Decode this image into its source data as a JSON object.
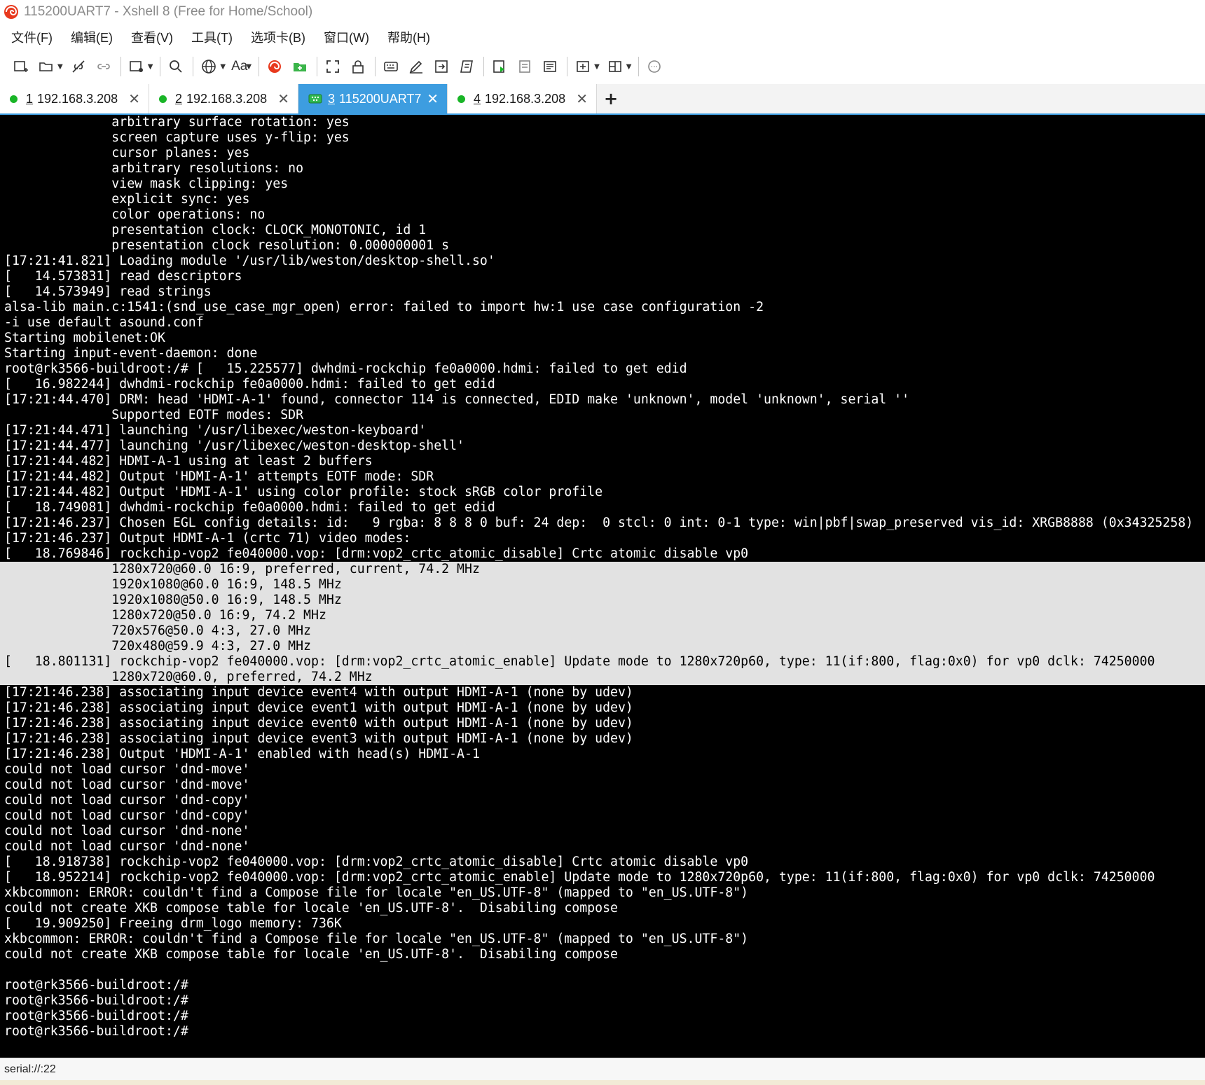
{
  "window": {
    "title": "115200UART7 - Xshell 8 (Free for Home/School)"
  },
  "menu": [
    {
      "label": "文件(F)"
    },
    {
      "label": "编辑(E)"
    },
    {
      "label": "查看(V)"
    },
    {
      "label": "工具(T)"
    },
    {
      "label": "选项卡(B)"
    },
    {
      "label": "窗口(W)"
    },
    {
      "label": "帮助(H)"
    }
  ],
  "toolbar": {
    "font_button_label": "Aa"
  },
  "tabs": [
    {
      "num": "1",
      "label": "192.168.3.208",
      "status_color": "#19b527"
    },
    {
      "num": "2",
      "label": "192.168.3.208",
      "status_color": "#19b527"
    },
    {
      "num": "3",
      "label": "115200UART7",
      "active": true
    },
    {
      "num": "4",
      "label": "192.168.3.208",
      "status_color": "#19b527"
    }
  ],
  "tab_add_label": "+",
  "tab_close_label": "✕",
  "terminal": {
    "lines": [
      {
        "text": "              arbitrary surface rotation: yes"
      },
      {
        "text": "              screen capture uses y-flip: yes"
      },
      {
        "text": "              cursor planes: yes"
      },
      {
        "text": "              arbitrary resolutions: no"
      },
      {
        "text": "              view mask clipping: yes"
      },
      {
        "text": "              explicit sync: yes"
      },
      {
        "text": "              color operations: no"
      },
      {
        "text": "              presentation clock: CLOCK_MONOTONIC, id 1"
      },
      {
        "text": "              presentation clock resolution: 0.000000001 s"
      },
      {
        "text": "[17:21:41.821] Loading module '/usr/lib/weston/desktop-shell.so'"
      },
      {
        "text": "[   14.573831] read descriptors"
      },
      {
        "text": "[   14.573949] read strings"
      },
      {
        "text": "alsa-lib main.c:1541:(snd_use_case_mgr_open) error: failed to import hw:1 use case configuration -2"
      },
      {
        "text": "-i use default asound.conf"
      },
      {
        "text": "Starting mobilenet:OK"
      },
      {
        "text": "Starting input-event-daemon: done"
      },
      {
        "text": "root@rk3566-buildroot:/# [   15.225577] dwhdmi-rockchip fe0a0000.hdmi: failed to get edid"
      },
      {
        "text": "[   16.982244] dwhdmi-rockchip fe0a0000.hdmi: failed to get edid"
      },
      {
        "text": "[17:21:44.470] DRM: head 'HDMI-A-1' found, connector 114 is connected, EDID make 'unknown', model 'unknown', serial ''"
      },
      {
        "text": "              Supported EOTF modes: SDR"
      },
      {
        "text": "[17:21:44.471] launching '/usr/libexec/weston-keyboard'"
      },
      {
        "text": "[17:21:44.477] launching '/usr/libexec/weston-desktop-shell'"
      },
      {
        "text": "[17:21:44.482] HDMI-A-1 using at least 2 buffers"
      },
      {
        "text": "[17:21:44.482] Output 'HDMI-A-1' attempts EOTF mode: SDR"
      },
      {
        "text": "[17:21:44.482] Output 'HDMI-A-1' using color profile: stock sRGB color profile"
      },
      {
        "text": "[   18.749081] dwhdmi-rockchip fe0a0000.hdmi: failed to get edid"
      },
      {
        "text": "[17:21:46.237] Chosen EGL config details: id:   9 rgba: 8 8 8 0 buf: 24 dep:  0 stcl: 0 int: 0-1 type: win|pbf|swap_preserved vis_id: XRGB8888 (0x34325258)"
      },
      {
        "text": "[17:21:46.237] Output HDMI-A-1 (crtc 71) video modes:"
      },
      {
        "text": "[   18.769846] rockchip-vop2 fe040000.vop: [drm:vop2_crtc_atomic_disable] Crtc atomic disable vp0"
      },
      {
        "text": "              1280x720@60.0 16:9, preferred, current, 74.2 MHz",
        "selected": true
      },
      {
        "text": "              1920x1080@60.0 16:9, 148.5 MHz",
        "selected": true
      },
      {
        "text": "              1920x1080@50.0 16:9, 148.5 MHz",
        "selected": true
      },
      {
        "text": "              1280x720@50.0 16:9, 74.2 MHz",
        "selected": true
      },
      {
        "text": "              720x576@50.0 4:3, 27.0 MHz",
        "selected": true
      },
      {
        "text": "              720x480@59.9 4:3, 27.0 MHz",
        "selected": true
      },
      {
        "text": "[   18.801131] rockchip-vop2 fe040000.vop: [drm:vop2_crtc_atomic_enable] Update mode to 1280x720p60, type: 11(if:800, flag:0x0) for vp0 dclk: 74250000",
        "selected": true
      },
      {
        "text": "              1280x720@60.0, preferred, 74.2 MHz",
        "selected": true
      },
      {
        "text": "[17:21:46.238] associating input device event4 with output HDMI-A-1 (none by udev)"
      },
      {
        "text": "[17:21:46.238] associating input device event1 with output HDMI-A-1 (none by udev)"
      },
      {
        "text": "[17:21:46.238] associating input device event0 with output HDMI-A-1 (none by udev)"
      },
      {
        "text": "[17:21:46.238] associating input device event3 with output HDMI-A-1 (none by udev)"
      },
      {
        "text": "[17:21:46.238] Output 'HDMI-A-1' enabled with head(s) HDMI-A-1"
      },
      {
        "text": "could not load cursor 'dnd-move'"
      },
      {
        "text": "could not load cursor 'dnd-move'"
      },
      {
        "text": "could not load cursor 'dnd-copy'"
      },
      {
        "text": "could not load cursor 'dnd-copy'"
      },
      {
        "text": "could not load cursor 'dnd-none'"
      },
      {
        "text": "could not load cursor 'dnd-none'"
      },
      {
        "text": "[   18.918738] rockchip-vop2 fe040000.vop: [drm:vop2_crtc_atomic_disable] Crtc atomic disable vp0"
      },
      {
        "text": "[   18.952214] rockchip-vop2 fe040000.vop: [drm:vop2_crtc_atomic_enable] Update mode to 1280x720p60, type: 11(if:800, flag:0x0) for vp0 dclk: 74250000"
      },
      {
        "text": "xkbcommon: ERROR: couldn't find a Compose file for locale \"en_US.UTF-8\" (mapped to \"en_US.UTF-8\")"
      },
      {
        "text": "could not create XKB compose table for locale 'en_US.UTF-8'.  Disabiling compose"
      },
      {
        "text": "[   19.909250] Freeing drm_logo memory: 736K"
      },
      {
        "text": "xkbcommon: ERROR: couldn't find a Compose file for locale \"en_US.UTF-8\" (mapped to \"en_US.UTF-8\")"
      },
      {
        "text": "could not create XKB compose table for locale 'en_US.UTF-8'.  Disabiling compose"
      },
      {
        "text": ""
      },
      {
        "text": "root@rk3566-buildroot:/#"
      },
      {
        "text": "root@rk3566-buildroot:/#"
      },
      {
        "text": "root@rk3566-buildroot:/#"
      },
      {
        "text": "root@rk3566-buildroot:/#"
      }
    ]
  },
  "status": {
    "text": "serial://:22"
  },
  "colors": {
    "accent": "#3d9de0",
    "connected": "#19b527",
    "terminal_bg": "#000000",
    "terminal_fg": "#ffffff",
    "selection_bg": "#e2e2e2"
  }
}
